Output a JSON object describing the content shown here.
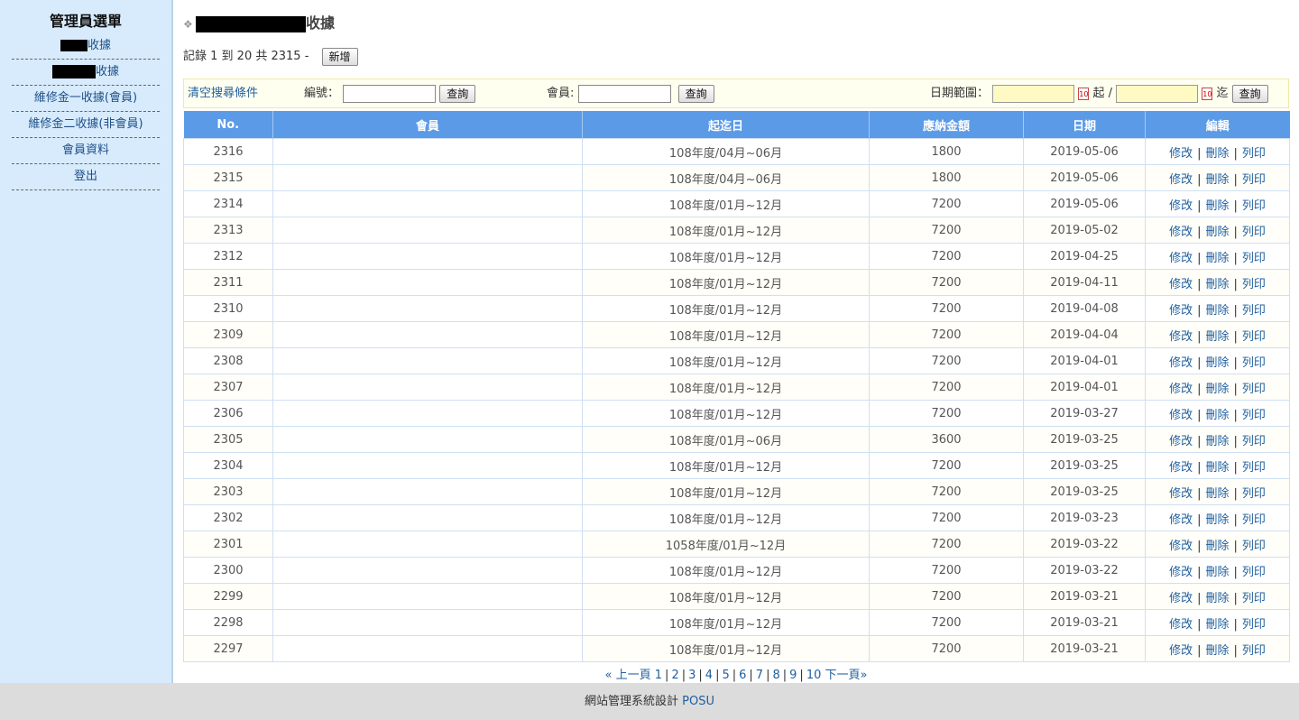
{
  "sidebar": {
    "title": "管理員選單",
    "items": [
      {
        "label": "收據"
      },
      {
        "label": "收據"
      },
      {
        "label": "維修金一收據(會員)"
      },
      {
        "label": "維修金二收據(非會員)"
      },
      {
        "label": "會員資料"
      },
      {
        "label": "登出"
      }
    ]
  },
  "page": {
    "title": "收據",
    "summary": "記錄 1 到 20 共 2315 -",
    "add_button": "新增"
  },
  "search": {
    "clear": "清空搜尋條件",
    "number_label": "編號：",
    "member_label": "會員:",
    "query": "查詢",
    "date_label": "日期範圍：",
    "cal_icon_text": "10",
    "from": "起",
    "slash": "/",
    "to": "迄"
  },
  "table": {
    "columns": [
      "No.",
      "會員",
      "起迄日",
      "應納金額",
      "日期",
      "編輯"
    ],
    "actions": {
      "edit": "修改",
      "delete": "刪除",
      "print": "列印",
      "sep": "|"
    },
    "rows": [
      {
        "no": "2316",
        "period": "108年度/04月~06月",
        "amount": "1800",
        "date": "2019-05-06"
      },
      {
        "no": "2315",
        "period": "108年度/04月~06月",
        "amount": "1800",
        "date": "2019-05-06"
      },
      {
        "no": "2314",
        "period": "108年度/01月~12月",
        "amount": "7200",
        "date": "2019-05-06"
      },
      {
        "no": "2313",
        "period": "108年度/01月~12月",
        "amount": "7200",
        "date": "2019-05-02"
      },
      {
        "no": "2312",
        "period": "108年度/01月~12月",
        "amount": "7200",
        "date": "2019-04-25"
      },
      {
        "no": "2311",
        "period": "108年度/01月~12月",
        "amount": "7200",
        "date": "2019-04-11"
      },
      {
        "no": "2310",
        "period": "108年度/01月~12月",
        "amount": "7200",
        "date": "2019-04-08"
      },
      {
        "no": "2309",
        "period": "108年度/01月~12月",
        "amount": "7200",
        "date": "2019-04-04"
      },
      {
        "no": "2308",
        "period": "108年度/01月~12月",
        "amount": "7200",
        "date": "2019-04-01"
      },
      {
        "no": "2307",
        "period": "108年度/01月~12月",
        "amount": "7200",
        "date": "2019-04-01"
      },
      {
        "no": "2306",
        "period": "108年度/01月~12月",
        "amount": "7200",
        "date": "2019-03-27"
      },
      {
        "no": "2305",
        "period": "108年度/01月~06月",
        "amount": "3600",
        "date": "2019-03-25"
      },
      {
        "no": "2304",
        "period": "108年度/01月~12月",
        "amount": "7200",
        "date": "2019-03-25"
      },
      {
        "no": "2303",
        "period": "108年度/01月~12月",
        "amount": "7200",
        "date": "2019-03-25"
      },
      {
        "no": "2302",
        "period": "108年度/01月~12月",
        "amount": "7200",
        "date": "2019-03-23"
      },
      {
        "no": "2301",
        "period": "1058年度/01月~12月",
        "amount": "7200",
        "date": "2019-03-22"
      },
      {
        "no": "2300",
        "period": "108年度/01月~12月",
        "amount": "7200",
        "date": "2019-03-22"
      },
      {
        "no": "2299",
        "period": "108年度/01月~12月",
        "amount": "7200",
        "date": "2019-03-21"
      },
      {
        "no": "2298",
        "period": "108年度/01月~12月",
        "amount": "7200",
        "date": "2019-03-21"
      },
      {
        "no": "2297",
        "period": "108年度/01月~12月",
        "amount": "7200",
        "date": "2019-03-21"
      }
    ]
  },
  "pager": {
    "prev": "« 上一頁",
    "pages": [
      "1",
      "2",
      "3",
      "4",
      "5",
      "6",
      "7",
      "8",
      "9",
      "10"
    ],
    "sep": "|",
    "next": "下一頁»"
  },
  "footer": {
    "text": "網站管理系統設計",
    "brand": "POSU"
  },
  "colors": {
    "sidebar_bg": "#d7ebfd",
    "header_bg": "#5b9ae6",
    "link": "#1f5fa0"
  }
}
